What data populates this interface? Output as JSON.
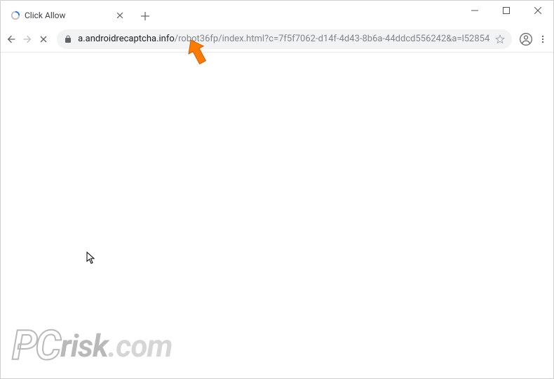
{
  "window": {
    "title": "Click Allow"
  },
  "tab": {
    "title": "Click Allow",
    "loading": true
  },
  "addressbar": {
    "domain": "a.androidrecaptcha.info",
    "path": "/robot36fp/index.html?c=7f5f7062-d14f-4d43-8b6a-44ddcd556242&a=l52854"
  },
  "watermark": {
    "prefix": "PC",
    "main": "risk",
    "suffix": ".com"
  }
}
